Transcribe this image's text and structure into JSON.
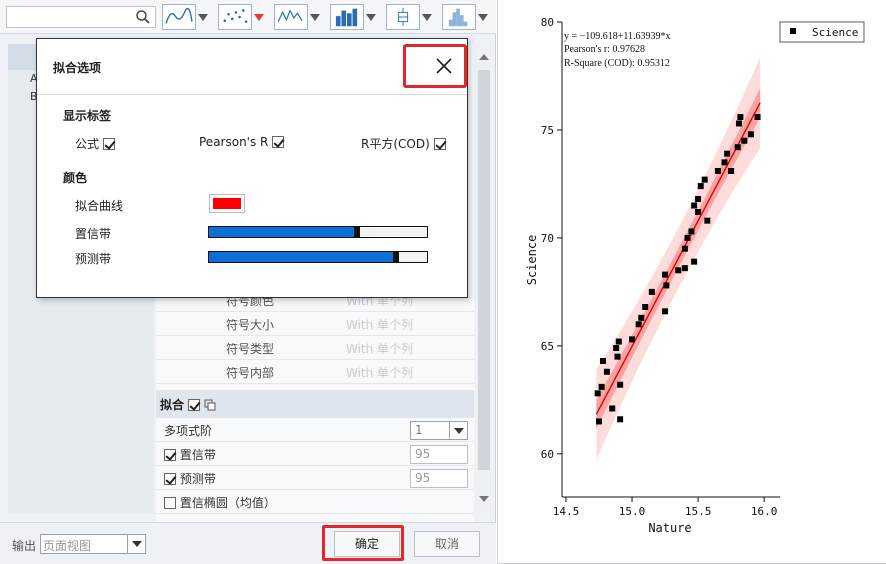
{
  "dialog": {
    "title": "拟合选项",
    "section_labels": "显示标签",
    "section_color": "颜色",
    "opt_formula": "公式",
    "opt_pearson": "Pearson's R",
    "opt_rsq": "R平方(COD)",
    "opt_formula_checked": true,
    "opt_pearson_checked": true,
    "opt_rsq_checked": true,
    "fit_curve_label": "拟合曲线",
    "conf_band_label": "置信带",
    "pred_band_label": "预测带",
    "fit_curve_color": "#ff0000",
    "band_color": "#0a6fd6",
    "conf_level": 0.68,
    "pred_level": 0.86
  },
  "props": {
    "symbol_color": "符号颜色",
    "symbol_size": "符号大小",
    "symbol_type": "符号类型",
    "symbol_fill": "符号内部",
    "value_placeholder": "With 单个列",
    "fit_section": "拟合",
    "poly_order_label": "多项式阶",
    "poly_order": "1",
    "conf_band": "置信带",
    "conf_value": "95",
    "pred_band": "预测带",
    "pred_value": "95",
    "conf_ellipse": "置信椭圆（均值）"
  },
  "bottom": {
    "output_label": "输出",
    "output_value": "页面视图",
    "ok": "确定",
    "cancel": "取消"
  },
  "chart_data": {
    "type": "scatter",
    "xlabel": "Nature",
    "ylabel": "Science",
    "xlim": [
      14.5,
      16.0
    ],
    "ylim": [
      58,
      80
    ],
    "xticks": [
      "14.5",
      "15.0",
      "15.5",
      "16.0"
    ],
    "yticks": [
      "60",
      "65",
      "70",
      "75",
      "80"
    ],
    "legend": "Science",
    "legend_position": "top-right",
    "equation": "y = −109.618+11.63939*x",
    "pearson": "Pearson's r: 0.97628",
    "rsq": "R-Square (COD): 0.95312",
    "fit": {
      "intercept": -109.618,
      "slope": 11.63939
    },
    "conf_half_width": 0.45,
    "pred_half_width": 1.4,
    "series": [
      {
        "name": "Science",
        "points": [
          [
            14.75,
            61.5
          ],
          [
            14.74,
            62.8
          ],
          [
            14.77,
            63.1
          ],
          [
            14.78,
            64.3
          ],
          [
            14.81,
            63.8
          ],
          [
            14.85,
            62.1
          ],
          [
            14.88,
            64.9
          ],
          [
            14.89,
            64.5
          ],
          [
            14.91,
            63.2
          ],
          [
            14.9,
            65.2
          ],
          [
            14.91,
            61.6
          ],
          [
            15.0,
            65.3
          ],
          [
            15.05,
            66.0
          ],
          [
            15.07,
            66.3
          ],
          [
            15.1,
            66.8
          ],
          [
            15.15,
            67.5
          ],
          [
            15.25,
            68.3
          ],
          [
            15.26,
            67.8
          ],
          [
            15.25,
            66.6
          ],
          [
            15.35,
            68.5
          ],
          [
            15.4,
            68.6
          ],
          [
            15.4,
            69.5
          ],
          [
            15.42,
            70.0
          ],
          [
            15.45,
            70.3
          ],
          [
            15.47,
            71.5
          ],
          [
            15.47,
            68.9
          ],
          [
            15.5,
            71.2
          ],
          [
            15.52,
            72.4
          ],
          [
            15.5,
            71.8
          ],
          [
            15.55,
            72.7
          ],
          [
            15.57,
            70.8
          ],
          [
            15.65,
            73.1
          ],
          [
            15.7,
            73.5
          ],
          [
            15.72,
            73.9
          ],
          [
            15.75,
            73.1
          ],
          [
            15.8,
            74.2
          ],
          [
            15.81,
            75.3
          ],
          [
            15.82,
            75.6
          ],
          [
            15.85,
            74.5
          ],
          [
            15.9,
            74.8
          ],
          [
            15.95,
            75.6
          ]
        ]
      }
    ]
  }
}
